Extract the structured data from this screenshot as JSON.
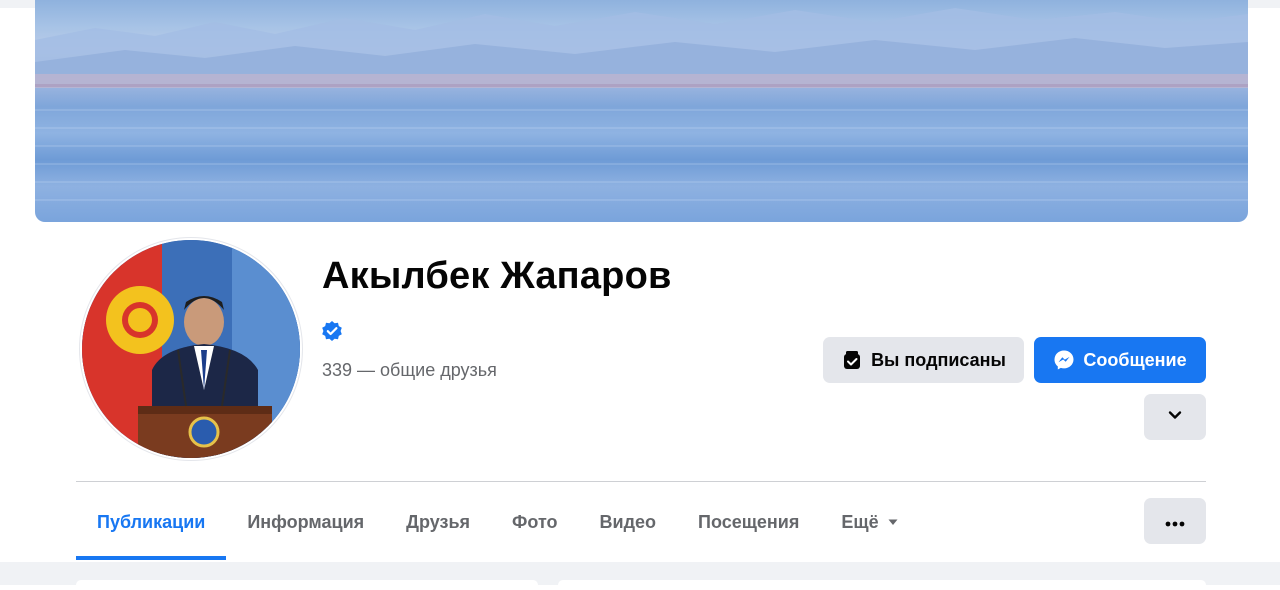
{
  "profile": {
    "name": "Акылбек Жапаров",
    "mutual_friends": "339 — общие друзья",
    "verified_icon": "verified-badge-icon"
  },
  "actions": {
    "subscribed_label": "Вы подписаны",
    "message_label": "Сообщение",
    "expand_icon": "chevron-down-icon",
    "more_icon": "more-dots-icon"
  },
  "tabs": [
    {
      "label": "Публикации",
      "active": true
    },
    {
      "label": "Информация",
      "active": false
    },
    {
      "label": "Друзья",
      "active": false
    },
    {
      "label": "Фото",
      "active": false
    },
    {
      "label": "Видео",
      "active": false
    },
    {
      "label": "Посещения",
      "active": false
    },
    {
      "label": "Ещё",
      "active": false
    }
  ],
  "colors": {
    "accent": "#1877f2",
    "secondary_button": "#e4e6eb",
    "muted_text": "#65676b"
  }
}
